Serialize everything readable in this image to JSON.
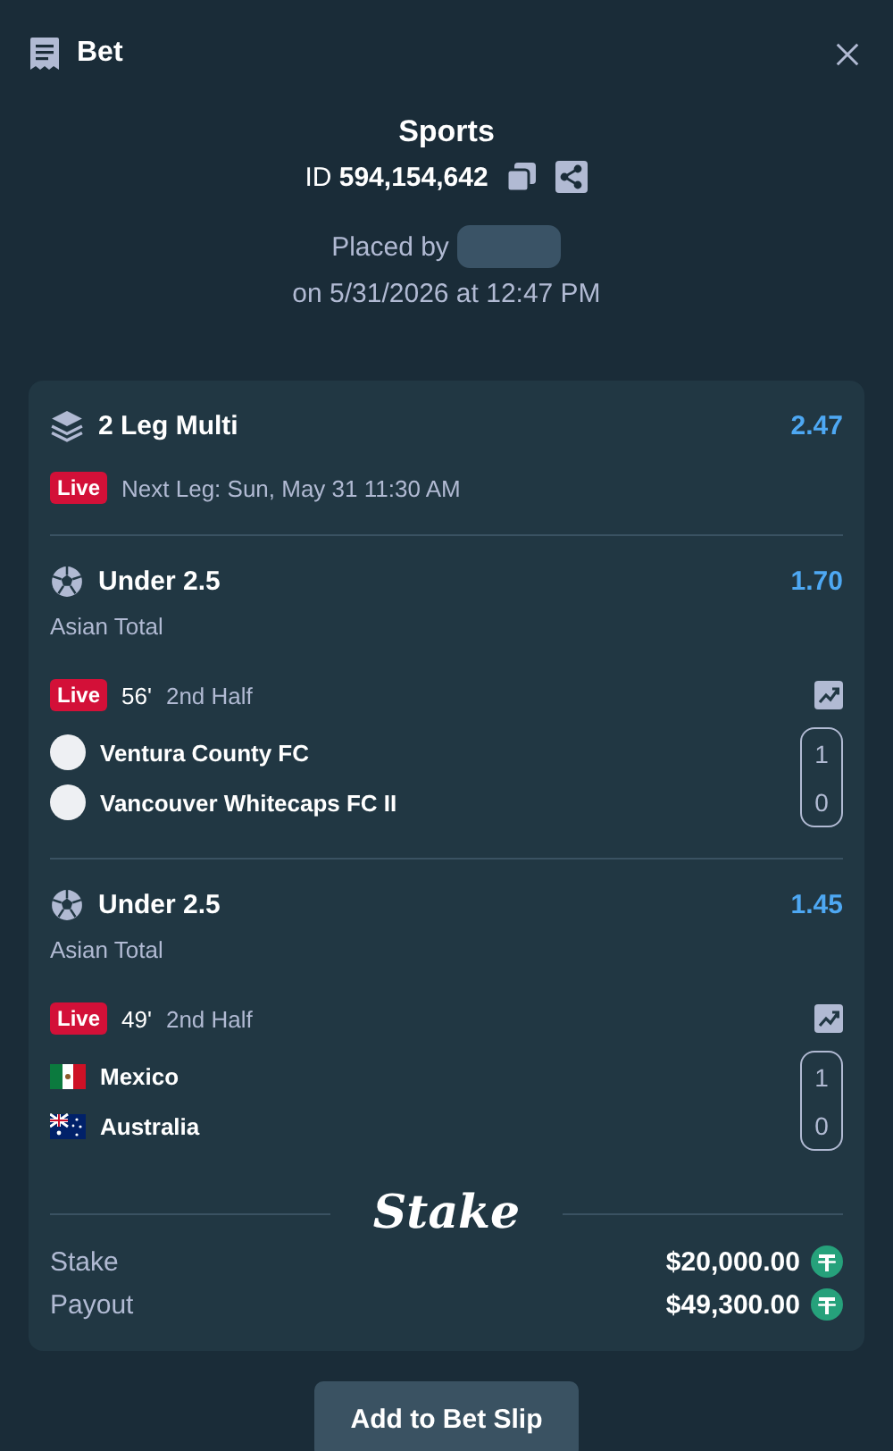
{
  "header": {
    "title": "Bet"
  },
  "bet": {
    "category": "Sports",
    "id_label": "ID",
    "id": "594,154,642",
    "placed_by_label": "Placed by",
    "placed_on": "on 5/31/2026 at 12:47 PM"
  },
  "multi": {
    "title": "2 Leg Multi",
    "odds": "2.47",
    "badge": "Live",
    "next_leg": "Next Leg: Sun, May 31 11:30 AM"
  },
  "legs": [
    {
      "selection": "Under 2.5",
      "odds": "1.70",
      "market": "Asian Total",
      "badge": "Live",
      "minute": "56'",
      "period": "2nd Half",
      "teams": [
        {
          "kind": "crest",
          "name": "Ventura County FC",
          "score": "1"
        },
        {
          "kind": "crest",
          "name": "Vancouver Whitecaps FC II",
          "score": "0"
        }
      ]
    },
    {
      "selection": "Under 2.5",
      "odds": "1.45",
      "market": "Asian Total",
      "badge": "Live",
      "minute": "49'",
      "period": "2nd Half",
      "teams": [
        {
          "kind": "flag",
          "name": "Mexico",
          "score": "1"
        },
        {
          "kind": "flag",
          "name": "Australia",
          "score": "0"
        }
      ]
    }
  ],
  "logo": "Stake",
  "totals": [
    {
      "label": "Stake",
      "amount": "$20,000.00"
    },
    {
      "label": "Payout",
      "amount": "$49,300.00"
    }
  ],
  "button": "Add to Bet Slip"
}
